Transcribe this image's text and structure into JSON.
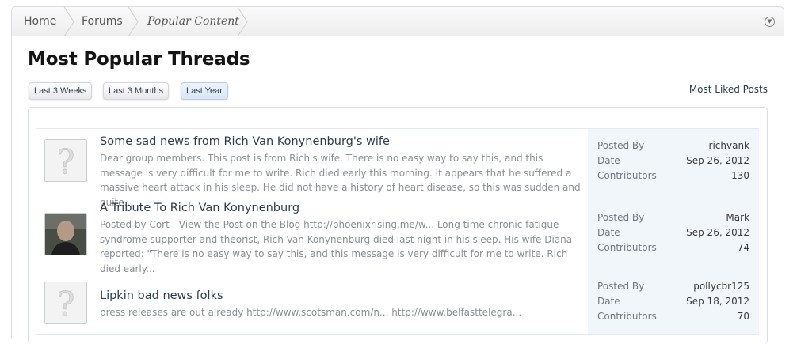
{
  "breadcrumb": {
    "home": "Home",
    "forums": "Forums",
    "current": "Popular Content"
  },
  "page_title": "Most Popular Threads",
  "periods": [
    "Last 3 Weeks",
    "Last 3 Months",
    "Last Year"
  ],
  "selected_period": "Last Year",
  "most_liked_link": "Most Liked Posts",
  "stat_labels": {
    "posted_by": "Posted By",
    "date": "Date",
    "contributors": "Contributors"
  },
  "threads": [
    {
      "title": "Some sad news from Rich Van Konynenburg's wife",
      "snippet": "Dear group members. This post is from Rich's wife. There is no easy way to say this, and this message is very difficult for me to write. Rich died early this morning. It appears that he suffered a massive heart attack in his sleep. He did not have a history of heart disease, so this was sudden and quite...",
      "posted_by": "richvank",
      "date": "Sep 26, 2012",
      "contributors": "130",
      "avatar": "default-avatar"
    },
    {
      "title": "A Tribute To Rich Van Konynenburg",
      "snippet": "Posted by Cort - View the Post on the Blog http://phoenixrising.me/w... Long time chronic fatigue syndrome supporter and theorist, Rich Van Konynenburg died last night in his sleep. His wife Diana reported: \"There is no easy way to say this, and this message is very difficult for me to write. Rich died early...",
      "posted_by": "Mark",
      "date": "Sep 26, 2012",
      "contributors": "74",
      "avatar": "user-photo"
    },
    {
      "title": "Lipkin bad news folks",
      "snippet": "press releases are out already http://www.scotsman.com/n... http://www.belfasttelegra...",
      "posted_by": "pollycbr125",
      "date": "Sep 18, 2012",
      "contributors": "70",
      "avatar": "default-avatar"
    }
  ]
}
